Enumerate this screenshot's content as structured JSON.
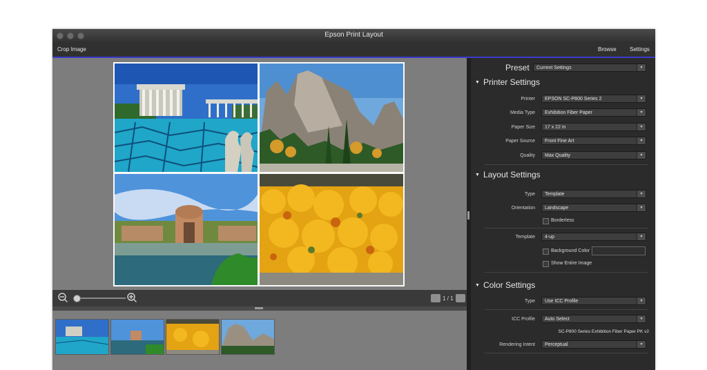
{
  "window": {
    "title": "Epson Print Layout"
  },
  "toolbar": {
    "crop": "Crop Image",
    "browse": "Browse",
    "settings": "Settings"
  },
  "preset": {
    "label": "Preset",
    "value": "Current Settings"
  },
  "printer_settings": {
    "title": "Printer Settings",
    "printer": {
      "label": "Printer",
      "value": "EPSON SC-P800 Series 2"
    },
    "media": {
      "label": "Media Type",
      "value": "Exhibition Fiber Paper"
    },
    "size": {
      "label": "Paper Size",
      "value": "17 x 22 in"
    },
    "source": {
      "label": "Paper Source",
      "value": "Front Fine Art"
    },
    "quality": {
      "label": "Quality",
      "value": "Max Quality"
    }
  },
  "layout_settings": {
    "title": "Layout Settings",
    "type": {
      "label": "Type",
      "value": "Template"
    },
    "orientation": {
      "label": "Orientation",
      "value": "Landscape"
    },
    "borderless": "Borderless",
    "template": {
      "label": "Template",
      "value": "4-up"
    },
    "background_color": "Background Color",
    "show_entire": "Show Entire Image"
  },
  "color_settings": {
    "title": "Color Settings",
    "type": {
      "label": "Type",
      "value": "Use ICC Profile"
    },
    "icc": {
      "label": "ICC Profile",
      "value": "Auto Select"
    },
    "profile_name": "SC-P800 Series Exhibition Fiber Paper PK v2",
    "intent": {
      "label": "Rendering Intent",
      "value": "Perceptual"
    }
  },
  "pager": {
    "text": "1 / 1"
  },
  "icons": {
    "zoom_out": "zoom-out-icon",
    "zoom_in": "zoom-in-icon",
    "dropdown": "chevron-down-icon",
    "collapse": "triangle-down-icon"
  },
  "colors": {
    "accent": "#3a3acd",
    "panel": "#2b2b2b",
    "preview_bg": "#7d7d7d"
  }
}
